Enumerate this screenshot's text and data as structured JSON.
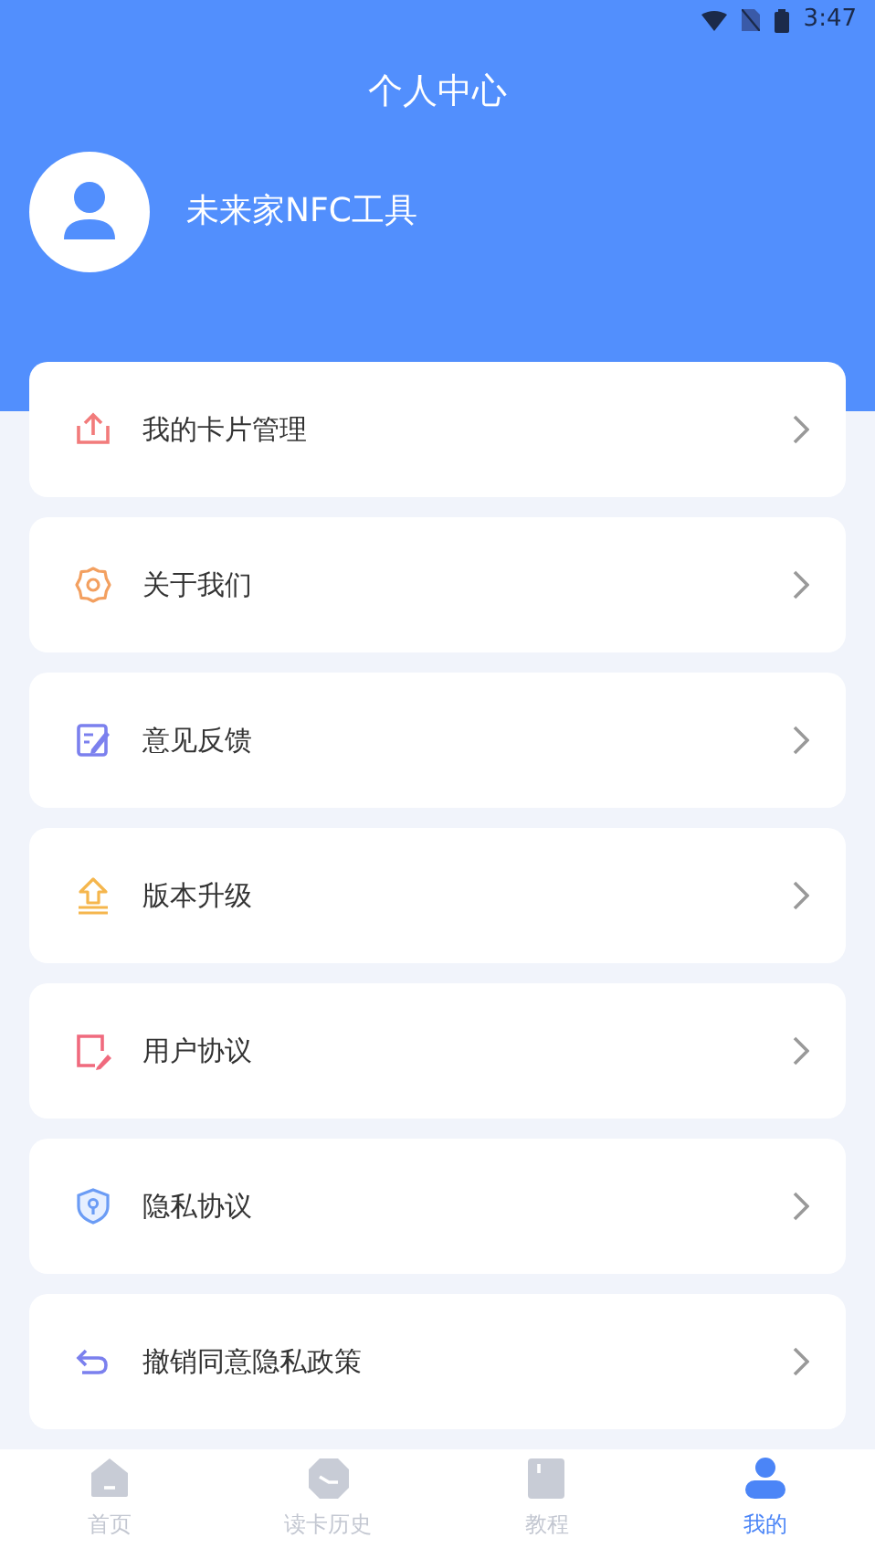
{
  "status_bar": {
    "time": "3:47"
  },
  "header": {
    "title": "个人中心",
    "username": "未来家NFC工具"
  },
  "menu": [
    {
      "kind": "upload",
      "label": "我的卡片管理"
    },
    {
      "kind": "gear",
      "label": "关于我们"
    },
    {
      "kind": "edit",
      "label": "意见反馈"
    },
    {
      "kind": "upgrade",
      "label": "版本升级"
    },
    {
      "kind": "note",
      "label": "用户协议"
    },
    {
      "kind": "shield",
      "label": "隐私协议"
    },
    {
      "kind": "undo",
      "label": "撤销同意隐私政策"
    }
  ],
  "tabs": [
    {
      "kind": "home",
      "label": "首页",
      "selected": false
    },
    {
      "kind": "clock",
      "label": "读卡历史",
      "selected": false
    },
    {
      "kind": "book",
      "label": "教程",
      "selected": false
    },
    {
      "kind": "person",
      "label": "我的",
      "selected": true
    }
  ]
}
